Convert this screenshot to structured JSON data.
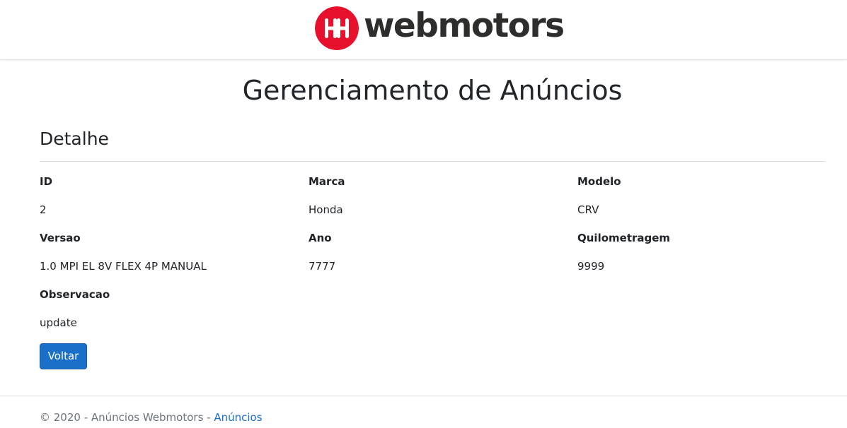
{
  "header": {
    "logo_text": "webmotors",
    "brand_color": "#e8112d",
    "logo_icon": "webmotors-logo-icon"
  },
  "page": {
    "title": "Gerenciamento de Anúncios"
  },
  "detail": {
    "heading": "Detalhe",
    "fields": [
      {
        "label": "ID",
        "value": "2"
      },
      {
        "label": "Marca",
        "value": "Honda"
      },
      {
        "label": "Modelo",
        "value": "CRV"
      },
      {
        "label": "Versao",
        "value": "1.0 MPI EL 8V FLEX 4P MANUAL"
      },
      {
        "label": "Ano",
        "value": "7777"
      },
      {
        "label": "Quilometragem",
        "value": "9999"
      },
      {
        "label": "Observacao",
        "value": "update"
      }
    ],
    "back_label": "Voltar"
  },
  "footer": {
    "text": "© 2020 - Anúncios Webmotors - ",
    "link_label": "Anúncios"
  },
  "colors": {
    "primary": "#1a6fc9",
    "text": "#212529",
    "muted": "#6c757d"
  }
}
